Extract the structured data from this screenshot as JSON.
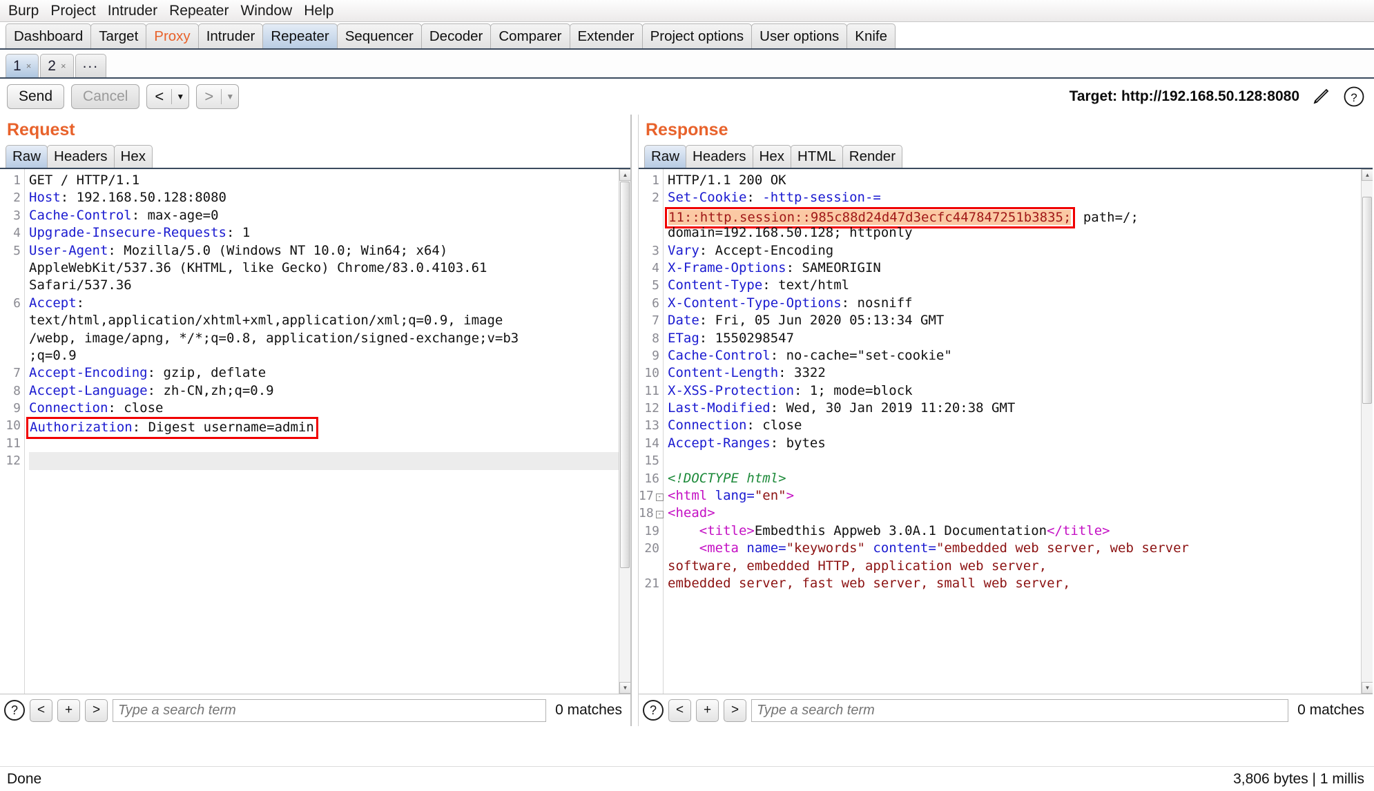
{
  "menubar": {
    "items": [
      "Burp",
      "Project",
      "Intruder",
      "Repeater",
      "Window",
      "Help"
    ]
  },
  "main_tabs": [
    {
      "label": "Dashboard",
      "state": "normal"
    },
    {
      "label": "Target",
      "state": "normal"
    },
    {
      "label": "Proxy",
      "state": "accent"
    },
    {
      "label": "Intruder",
      "state": "normal"
    },
    {
      "label": "Repeater",
      "state": "active"
    },
    {
      "label": "Sequencer",
      "state": "normal"
    },
    {
      "label": "Decoder",
      "state": "normal"
    },
    {
      "label": "Comparer",
      "state": "normal"
    },
    {
      "label": "Extender",
      "state": "normal"
    },
    {
      "label": "Project options",
      "state": "normal"
    },
    {
      "label": "User options",
      "state": "normal"
    },
    {
      "label": "Knife",
      "state": "normal"
    }
  ],
  "repeater_tabs": [
    {
      "label": "1",
      "close": "×",
      "active": true
    },
    {
      "label": "2",
      "close": "×",
      "active": false
    },
    {
      "label": "...",
      "close": "",
      "active": false
    }
  ],
  "toolbar": {
    "send_label": "Send",
    "cancel_label": "Cancel",
    "back_label": "<",
    "back_caret": "▼",
    "forward_label": ">",
    "forward_caret": "▼",
    "target_label": "Target: http://192.168.50.128:8080",
    "edit_icon": "pencil-icon",
    "help_icon": "question-icon"
  },
  "request": {
    "title": "Request",
    "tabs": [
      {
        "label": "Raw",
        "active": true
      },
      {
        "label": "Headers",
        "active": false
      },
      {
        "label": "Hex",
        "active": false
      }
    ],
    "lines": [
      {
        "n": "1",
        "segments": [
          {
            "t": "GET / HTTP/1.1",
            "c": "plain"
          }
        ]
      },
      {
        "n": "2",
        "segments": [
          {
            "t": "Host",
            "c": "hdr"
          },
          {
            "t": ": 192.168.50.128:8080",
            "c": "plain"
          }
        ]
      },
      {
        "n": "3",
        "segments": [
          {
            "t": "Cache-Control",
            "c": "hdr"
          },
          {
            "t": ": max-age=0",
            "c": "plain"
          }
        ]
      },
      {
        "n": "4",
        "segments": [
          {
            "t": "Upgrade-Insecure-Requests",
            "c": "hdr"
          },
          {
            "t": ": 1",
            "c": "plain"
          }
        ]
      },
      {
        "n": "5",
        "segments": [
          {
            "t": "User-Agent",
            "c": "hdr"
          },
          {
            "t": ": Mozilla/5.0 (Windows NT 10.0; Win64; x64)",
            "c": "plain"
          }
        ]
      },
      {
        "n": "",
        "segments": [
          {
            "t": "AppleWebKit/537.36 (KHTML, like Gecko) Chrome/83.0.4103.61",
            "c": "plain"
          }
        ]
      },
      {
        "n": "",
        "segments": [
          {
            "t": "Safari/537.36",
            "c": "plain"
          }
        ]
      },
      {
        "n": "6",
        "segments": [
          {
            "t": "Accept",
            "c": "hdr"
          },
          {
            "t": ":",
            "c": "plain"
          }
        ]
      },
      {
        "n": "",
        "segments": [
          {
            "t": "text/html,application/xhtml+xml,application/xml;q=0.9, image",
            "c": "plain"
          }
        ]
      },
      {
        "n": "",
        "segments": [
          {
            "t": "/webp, image/apng, */*;q=0.8, application/signed-exchange;v=b3",
            "c": "plain"
          }
        ]
      },
      {
        "n": "",
        "segments": [
          {
            "t": ";q=0.9",
            "c": "plain"
          }
        ]
      },
      {
        "n": "7",
        "segments": [
          {
            "t": "Accept-Encoding",
            "c": "hdr"
          },
          {
            "t": ": gzip, deflate",
            "c": "plain"
          }
        ]
      },
      {
        "n": "8",
        "segments": [
          {
            "t": "Accept-Language",
            "c": "hdr"
          },
          {
            "t": ": zh-CN,zh;q=0.9",
            "c": "plain"
          }
        ]
      },
      {
        "n": "9",
        "segments": [
          {
            "t": "Connection",
            "c": "hdr"
          },
          {
            "t": ": close",
            "c": "plain"
          }
        ]
      },
      {
        "n": "10",
        "boxed": true,
        "segments": [
          {
            "t": "Authorization",
            "c": "hdr"
          },
          {
            "t": ": Digest username=admin",
            "c": "plain"
          }
        ]
      },
      {
        "n": "11",
        "segments": []
      },
      {
        "n": "12",
        "highlight": true,
        "segments": []
      }
    ],
    "search": {
      "help": "?",
      "prev": "<",
      "add": "+",
      "next": ">",
      "placeholder": "Type a search term",
      "value": "",
      "matches": "0 matches"
    }
  },
  "response": {
    "title": "Response",
    "tabs": [
      {
        "label": "Raw",
        "active": true
      },
      {
        "label": "Headers",
        "active": false
      },
      {
        "label": "Hex",
        "active": false
      },
      {
        "label": "HTML",
        "active": false
      },
      {
        "label": "Render",
        "active": false
      }
    ],
    "lines": [
      {
        "n": "1",
        "segments": [
          {
            "t": "HTTP/1.1 200 OK",
            "c": "plain"
          }
        ]
      },
      {
        "n": "2",
        "segments": [
          {
            "t": "Set-Cookie",
            "c": "hdr"
          },
          {
            "t": ": ",
            "c": "plain"
          },
          {
            "t": "-http-session-=",
            "c": "hdr"
          }
        ]
      },
      {
        "n": "",
        "cookiebox": true,
        "token": "11::http.session::985c88d24d47d3ecfc447847251b3835;",
        "tail": " path=/;",
        "segments": []
      },
      {
        "n": "",
        "segments": [
          {
            "t": "domain=192.168.50.128; httponly",
            "c": "plain"
          }
        ]
      },
      {
        "n": "3",
        "segments": [
          {
            "t": "Vary",
            "c": "hdr"
          },
          {
            "t": ": Accept-Encoding",
            "c": "plain"
          }
        ]
      },
      {
        "n": "4",
        "segments": [
          {
            "t": "X-Frame-Options",
            "c": "hdr"
          },
          {
            "t": ": SAMEORIGIN",
            "c": "plain"
          }
        ]
      },
      {
        "n": "5",
        "segments": [
          {
            "t": "Content-Type",
            "c": "hdr"
          },
          {
            "t": ": text/html",
            "c": "plain"
          }
        ]
      },
      {
        "n": "6",
        "segments": [
          {
            "t": "X-Content-Type-Options",
            "c": "hdr"
          },
          {
            "t": ": nosniff",
            "c": "plain"
          }
        ]
      },
      {
        "n": "7",
        "segments": [
          {
            "t": "Date",
            "c": "hdr"
          },
          {
            "t": ": Fri, 05 Jun 2020 05:13:34 GMT",
            "c": "plain"
          }
        ]
      },
      {
        "n": "8",
        "segments": [
          {
            "t": "ETag",
            "c": "hdr"
          },
          {
            "t": ": 1550298547",
            "c": "plain"
          }
        ]
      },
      {
        "n": "9",
        "segments": [
          {
            "t": "Cache-Control",
            "c": "hdr"
          },
          {
            "t": ": no-cache=\"set-cookie\"",
            "c": "plain"
          }
        ]
      },
      {
        "n": "10",
        "segments": [
          {
            "t": "Content-Length",
            "c": "hdr"
          },
          {
            "t": ": 3322",
            "c": "plain"
          }
        ]
      },
      {
        "n": "11",
        "segments": [
          {
            "t": "X-XSS-Protection",
            "c": "hdr"
          },
          {
            "t": ": 1; mode=block",
            "c": "plain"
          }
        ]
      },
      {
        "n": "12",
        "segments": [
          {
            "t": "Last-Modified",
            "c": "hdr"
          },
          {
            "t": ": Wed, 30 Jan 2019 11:20:38 GMT",
            "c": "plain"
          }
        ]
      },
      {
        "n": "13",
        "segments": [
          {
            "t": "Connection",
            "c": "hdr"
          },
          {
            "t": ": close",
            "c": "plain"
          }
        ]
      },
      {
        "n": "14",
        "segments": [
          {
            "t": "Accept-Ranges",
            "c": "hdr"
          },
          {
            "t": ": bytes",
            "c": "plain"
          }
        ]
      },
      {
        "n": "15",
        "segments": []
      },
      {
        "n": "16",
        "segments": [
          {
            "t": "<!DOCTYPE html>",
            "c": "doctype"
          }
        ]
      },
      {
        "n": "17",
        "fold": true,
        "segments": [
          {
            "t": "<html",
            "c": "tagn"
          },
          {
            "t": " lang=",
            "c": "attrn"
          },
          {
            "t": "\"en\"",
            "c": "attrv"
          },
          {
            "t": ">",
            "c": "tagn"
          }
        ]
      },
      {
        "n": "18",
        "fold": true,
        "segments": [
          {
            "t": "<head>",
            "c": "tagn"
          }
        ]
      },
      {
        "n": "19",
        "segments": [
          {
            "t": "    <title>",
            "c": "tagn"
          },
          {
            "t": "Embedthis Appweb 3.0A.1 Documentation",
            "c": "plain"
          },
          {
            "t": "</title>",
            "c": "tagn"
          }
        ]
      },
      {
        "n": "20",
        "segments": [
          {
            "t": "    <meta",
            "c": "tagn"
          },
          {
            "t": " name=",
            "c": "attrn"
          },
          {
            "t": "\"keywords\"",
            "c": "attrv"
          },
          {
            "t": " content=",
            "c": "attrn"
          },
          {
            "t": "\"embedded web server, web server",
            "c": "attrv"
          }
        ]
      },
      {
        "n": "",
        "segments": [
          {
            "t": "software, embedded HTTP, application web server,",
            "c": "attrv"
          }
        ]
      },
      {
        "n": "21",
        "clipped": true,
        "segments": [
          {
            "t": "embedded server, fast web server, small web server, ",
            "c": "attrv"
          }
        ]
      }
    ],
    "search": {
      "help": "?",
      "prev": "<",
      "add": "+",
      "next": ">",
      "placeholder": "Type a search term",
      "value": "",
      "matches": "0 matches"
    }
  },
  "statusbar": {
    "left": "Done",
    "right": "3,806 bytes | 1 millis"
  },
  "colors": {
    "accent_orange": "#e8622b",
    "header_blue": "#1a1ad0",
    "highlight_box_red": "#f00000",
    "token_bg": "#fbc9a4",
    "token_fg": "#a01818",
    "tag_magenta": "#c410c4",
    "attr_value_red": "#8c1212",
    "doctype_green": "#1d8a3a"
  }
}
